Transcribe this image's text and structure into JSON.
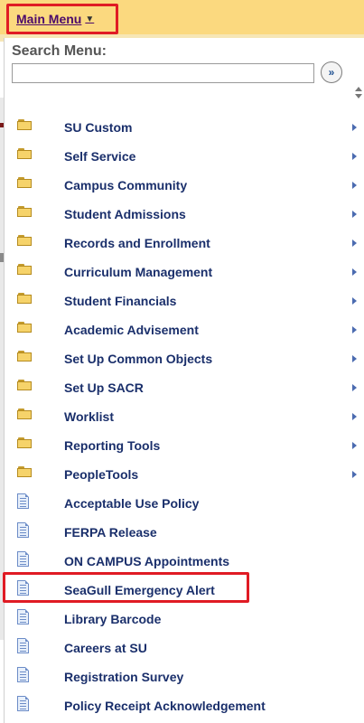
{
  "header": {
    "main_menu_label": "Main Menu",
    "caret_icon": "caret-down-icon"
  },
  "search": {
    "label": "Search Menu:",
    "value": "",
    "placeholder": "",
    "go_icon": "double-chevron-right-icon"
  },
  "menu": {
    "items": [
      {
        "label": "SU Custom",
        "type": "folder",
        "has_submenu": true
      },
      {
        "label": "Self Service",
        "type": "folder",
        "has_submenu": true
      },
      {
        "label": "Campus Community",
        "type": "folder",
        "has_submenu": true
      },
      {
        "label": "Student Admissions",
        "type": "folder",
        "has_submenu": true
      },
      {
        "label": "Records and Enrollment",
        "type": "folder",
        "has_submenu": true
      },
      {
        "label": "Curriculum Management",
        "type": "folder",
        "has_submenu": true
      },
      {
        "label": "Student Financials",
        "type": "folder",
        "has_submenu": true
      },
      {
        "label": "Academic Advisement",
        "type": "folder",
        "has_submenu": true
      },
      {
        "label": "Set Up Common Objects",
        "type": "folder",
        "has_submenu": true
      },
      {
        "label": "Set Up SACR",
        "type": "folder",
        "has_submenu": true
      },
      {
        "label": "Worklist",
        "type": "folder",
        "has_submenu": true
      },
      {
        "label": "Reporting Tools",
        "type": "folder",
        "has_submenu": true
      },
      {
        "label": "PeopleTools",
        "type": "folder",
        "has_submenu": true
      },
      {
        "label": "Acceptable Use Policy",
        "type": "document",
        "has_submenu": false
      },
      {
        "label": "FERPA Release",
        "type": "document",
        "has_submenu": false
      },
      {
        "label": "ON CAMPUS Appointments",
        "type": "document",
        "has_submenu": false
      },
      {
        "label": "SeaGull Emergency Alert",
        "type": "document",
        "has_submenu": false,
        "highlighted": true
      },
      {
        "label": "Library Barcode",
        "type": "document",
        "has_submenu": false
      },
      {
        "label": "Careers at SU",
        "type": "document",
        "has_submenu": false
      },
      {
        "label": "Registration Survey",
        "type": "document",
        "has_submenu": false
      },
      {
        "label": "Policy Receipt Acknowledgement",
        "type": "document",
        "has_submenu": false
      }
    ]
  },
  "colors": {
    "header_bg": "#fbd97f",
    "highlight_border": "#e01b24",
    "menu_text": "#1a2f6b",
    "main_menu_text": "#4b0a6b"
  }
}
